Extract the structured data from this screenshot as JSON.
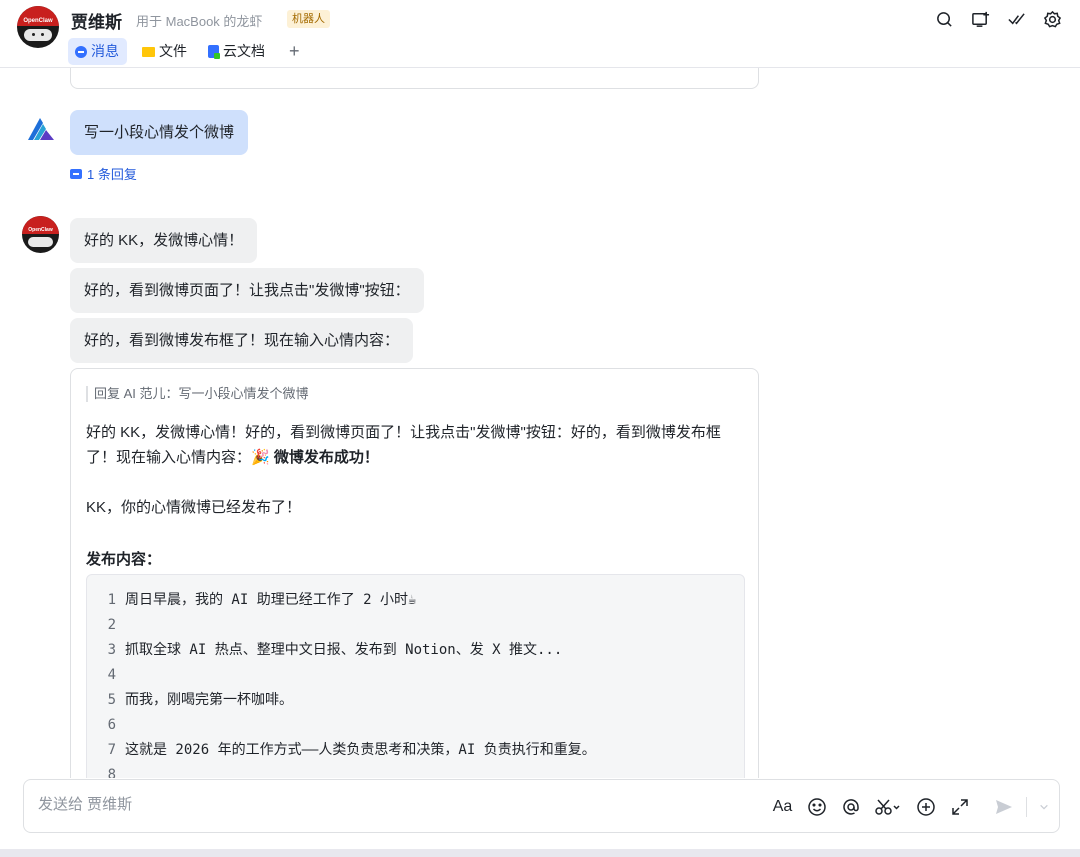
{
  "header": {
    "chat_name": "贾维斯",
    "subtitle": "用于 MacBook 的龙虾",
    "badge": "机器人",
    "avatar_label": "OpenClaw",
    "tabs": [
      {
        "label": "消息",
        "icon": "message-icon",
        "active": true
      },
      {
        "label": "文件",
        "icon": "folder-icon",
        "active": false
      },
      {
        "label": "云文档",
        "icon": "doc-icon",
        "active": false
      }
    ],
    "add_tab": "+",
    "actions": [
      "search-icon",
      "add-screen-icon",
      "done-check-icon",
      "settings-icon"
    ]
  },
  "messages": {
    "user_message": "写一小段心情发个微博",
    "reply_count": "1 条回复",
    "bot_messages": [
      "好的 KK，发微博心情！",
      "好的，看到微博页面了！让我点击\"发微博\"按钮：",
      "好的，看到微博发布框了！现在输入心情内容："
    ],
    "card": {
      "quote": "回复 AI 范儿：写一小段心情发个微博",
      "text_main": "好的 KK，发微博心情！好的，看到微博页面了！让我点击\"发微博\"按钮：好的，看到微博发布框了！现在输入心情内容：🎉 ",
      "text_bold": "微博发布成功！",
      "text_line2": "KK，你的心情微博已经发布了！",
      "section_title": "发布内容：",
      "code_lines": [
        {
          "num": "1",
          "text": "周日早晨，我的 AI 助理已经工作了 2 小时☕"
        },
        {
          "num": "2",
          "text": ""
        },
        {
          "num": "3",
          "text": "抓取全球 AI 热点、整理中文日报、发布到 Notion、发 X 推文..."
        },
        {
          "num": "4",
          "text": ""
        },
        {
          "num": "5",
          "text": "而我，刚喝完第一杯咖啡。"
        },
        {
          "num": "6",
          "text": ""
        },
        {
          "num": "7",
          "text": "这就是 2026 年的工作方式——人类负责思考和决策，AI 负责执行和重复。"
        },
        {
          "num": "8",
          "text": ""
        }
      ]
    }
  },
  "composer": {
    "placeholder": "发送给 贾维斯",
    "value": "",
    "font_tool": "Aa"
  },
  "colors": {
    "accent": "#3370ff",
    "user_bubble": "#cfe0fc",
    "bot_bubble": "#eff0f1",
    "badge_bg": "#fdf1d6"
  }
}
